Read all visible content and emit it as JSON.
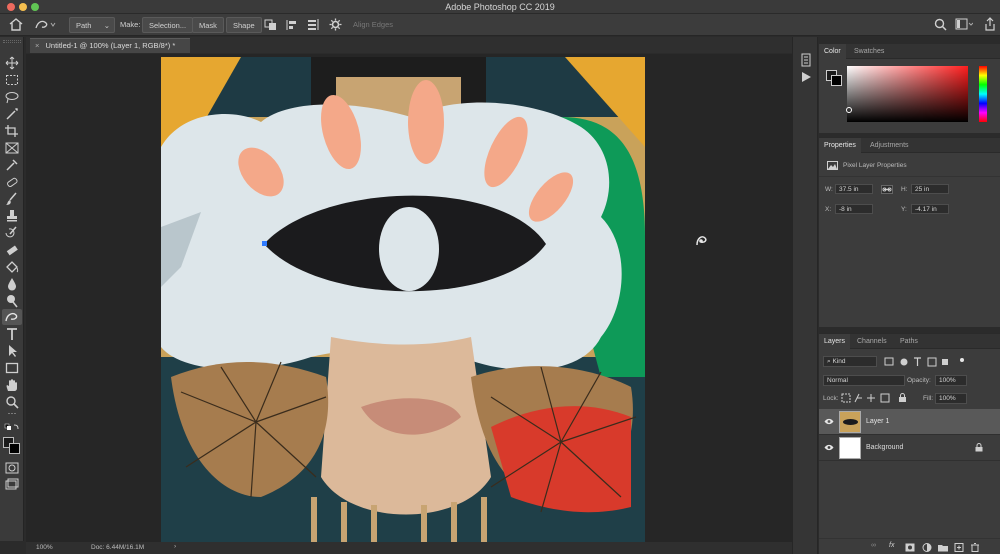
{
  "app": {
    "title": "Adobe Photoshop CC 2019"
  },
  "options": {
    "mode_value": "Path",
    "make_label": "Make:",
    "selection_label": "Selection...",
    "mask_label": "Mask",
    "shape_label": "Shape",
    "align_edges_label": "Align Edges"
  },
  "document": {
    "tab_label": "Untitled-1 @ 100% (Layer 1, RGB/8*) *"
  },
  "status": {
    "zoom": "100%",
    "doc": "Doc: 6.44M/16.1M"
  },
  "color_panel": {
    "tabs": [
      "Color",
      "Swatches"
    ],
    "colors": {
      "hue": "#ff1e1e"
    }
  },
  "properties_panel": {
    "tabs": [
      "Properties",
      "Adjustments"
    ],
    "kind_label": "Pixel Layer Properties",
    "w_label": "W:",
    "w_value": "37.5 in",
    "h_label": "H:",
    "h_value": "25 in",
    "x_label": "X:",
    "x_value": "-8 in",
    "y_label": "Y:",
    "y_value": "-4.17 in"
  },
  "layers_panel": {
    "tabs": [
      "Layers",
      "Channels",
      "Paths"
    ],
    "filter_value": "Kind",
    "blend_value": "Normal",
    "opacity_label": "Opacity:",
    "opacity_value": "100%",
    "lock_label": "Lock:",
    "fill_label": "Fill:",
    "fill_value": "100%",
    "layers": [
      {
        "name": "Layer 1"
      },
      {
        "name": "Background"
      }
    ],
    "footer_fx": "fx"
  },
  "colors": {
    "app_bg": "#2b2b2b",
    "panel_bg": "#3c3c3c",
    "selected_layer": "#595959",
    "path_anchor": "#2f7bff"
  }
}
